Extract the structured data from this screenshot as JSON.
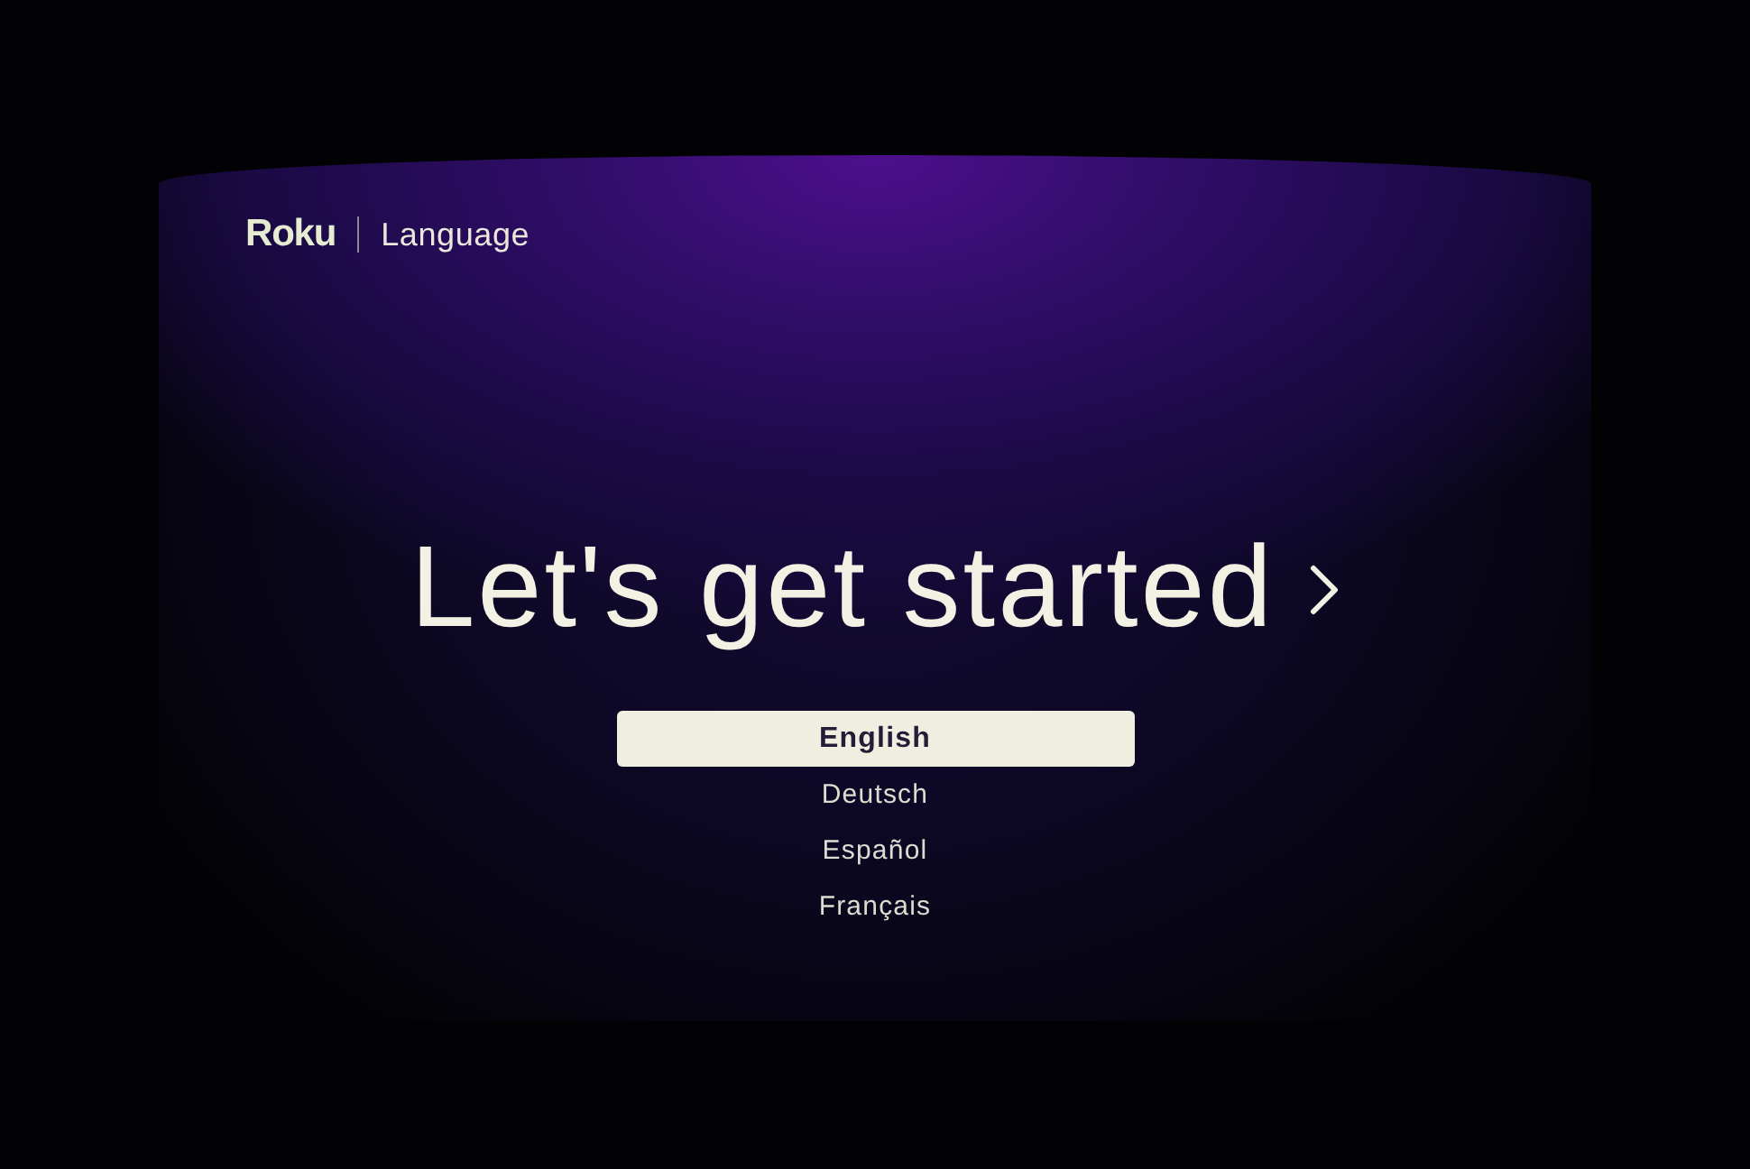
{
  "header": {
    "logo": "Roku",
    "title": "Language"
  },
  "headline": "Let's get started",
  "languages": [
    {
      "label": "English",
      "selected": true
    },
    {
      "label": "Deutsch",
      "selected": false
    },
    {
      "label": "Español",
      "selected": false
    },
    {
      "label": "Français",
      "selected": false
    }
  ]
}
